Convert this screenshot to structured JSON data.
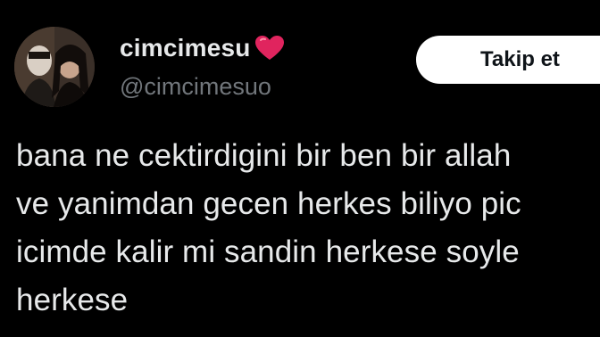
{
  "header": {
    "display_name": "cimcimesu",
    "handle": "@cimcimesuo",
    "verified_badge_icon": "red-heart-icon",
    "avatar_icon": "profile-photo-avatar"
  },
  "actions": {
    "follow_label": "Takip et"
  },
  "tweet": {
    "lines": [
      "bana ne cektirdigini bir ben bir allah",
      "ve yanimdan gecen herkes biliyo pic",
      "icimde kalir mi sandin herkese soyle",
      "herkese"
    ]
  },
  "colors": {
    "background": "#000000",
    "primary_text": "#e7e9ea",
    "secondary_text": "#71767b",
    "heart": "#e0245e",
    "button_bg": "#ffffff",
    "button_text": "#0f1419"
  }
}
